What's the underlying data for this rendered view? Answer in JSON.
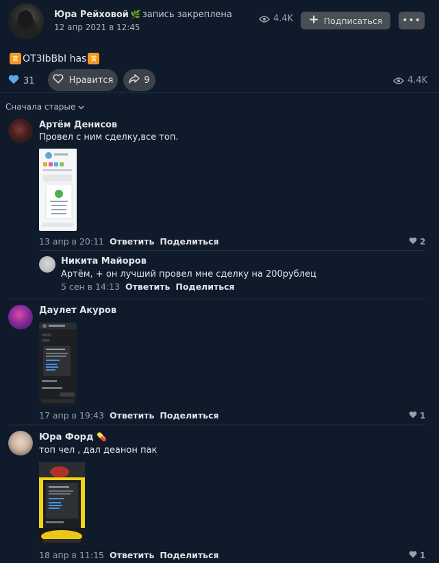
{
  "post": {
    "author": "Юра Рейховой",
    "pinned_label": "запись закреплена",
    "date": "12 апр 2021 в 12:45",
    "views": "4.4K",
    "subscribe_label": "Подписаться",
    "more_label": "•••",
    "text": "OT3IbBbI has",
    "likes_count": "31",
    "like_button_label": "Нравится",
    "shares_count": "9",
    "views_bottom": "4.4K"
  },
  "comments": {
    "sort_label": "Сначала старые",
    "reply_label": "Ответить",
    "share_label": "Поделиться",
    "items": [
      {
        "name": "Артём Денисов",
        "text": "Провел с ним сделку,все топ.",
        "date": "13 апр в 20:11",
        "likes": "2"
      },
      {
        "name": "Никита Майоров",
        "text": "Артём, + он лучший провел мне сделку на 200рублец",
        "date": "5 сен в 14:13",
        "likes": ""
      },
      {
        "name": "Даулет Акуров",
        "text": "",
        "date": "17 апр в 19:43",
        "likes": "1"
      },
      {
        "name": "Юра Форд",
        "text": "топ чел , дал деанон пак",
        "date": "18 апр в 11:15",
        "likes": "1"
      }
    ]
  },
  "colors": {
    "background": "#0f1a2b",
    "button": "#4a4f56",
    "accent_like": "#5da8e6"
  }
}
